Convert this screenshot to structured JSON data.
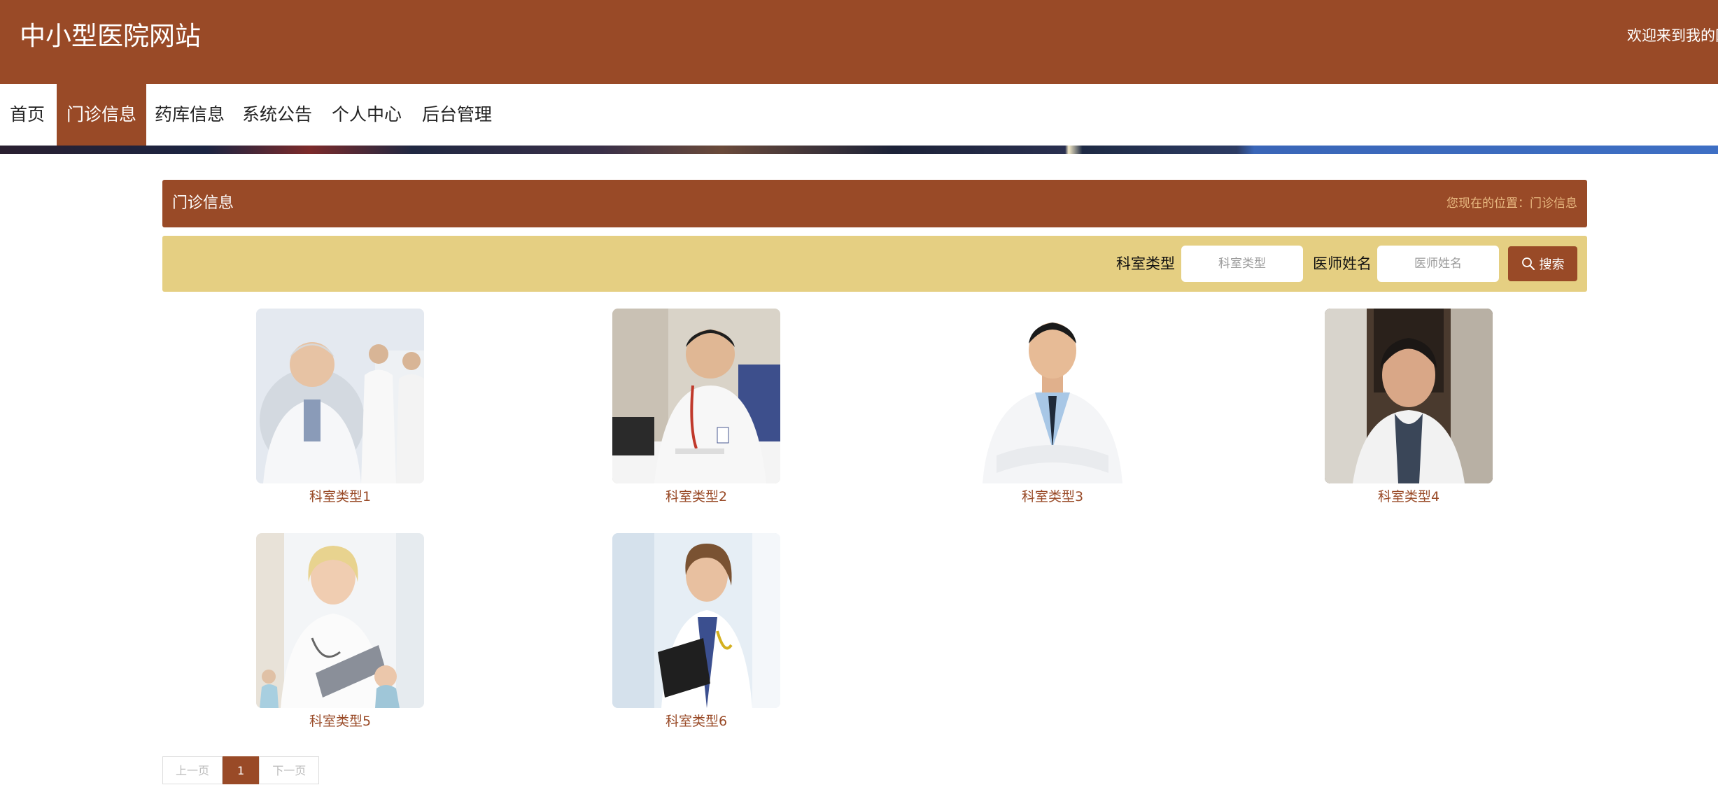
{
  "header": {
    "site_title": "中小型医院网站",
    "welcome": "欢迎来到我的网"
  },
  "nav": {
    "items": [
      {
        "label": "首页"
      },
      {
        "label": "门诊信息",
        "active": true
      },
      {
        "label": "药库信息"
      },
      {
        "label": "系统公告"
      },
      {
        "label": "个人中心"
      },
      {
        "label": "后台管理"
      }
    ]
  },
  "title_bar": {
    "title": "门诊信息",
    "location": "您现在的位置：门诊信息"
  },
  "search": {
    "dept_label": "科室类型",
    "dept_placeholder": "科室类型",
    "doctor_label": "医师姓名",
    "doctor_placeholder": "医师姓名",
    "button_label": "搜索",
    "button_icon": "search-icon"
  },
  "cards": [
    {
      "label": "科室类型1",
      "photo": "doctor-photo-1"
    },
    {
      "label": "科室类型2",
      "photo": "doctor-photo-2"
    },
    {
      "label": "科室类型3",
      "photo": "doctor-photo-3"
    },
    {
      "label": "科室类型4",
      "photo": "doctor-photo-4"
    },
    {
      "label": "科室类型5",
      "photo": "doctor-photo-5"
    },
    {
      "label": "科室类型6",
      "photo": "doctor-photo-6"
    }
  ],
  "pagination": {
    "prev": "上一页",
    "current": "1",
    "next": "下一页"
  },
  "colors": {
    "brand": "#994a27",
    "search_bar": "#e5cf82",
    "location_text": "#e8b880"
  }
}
